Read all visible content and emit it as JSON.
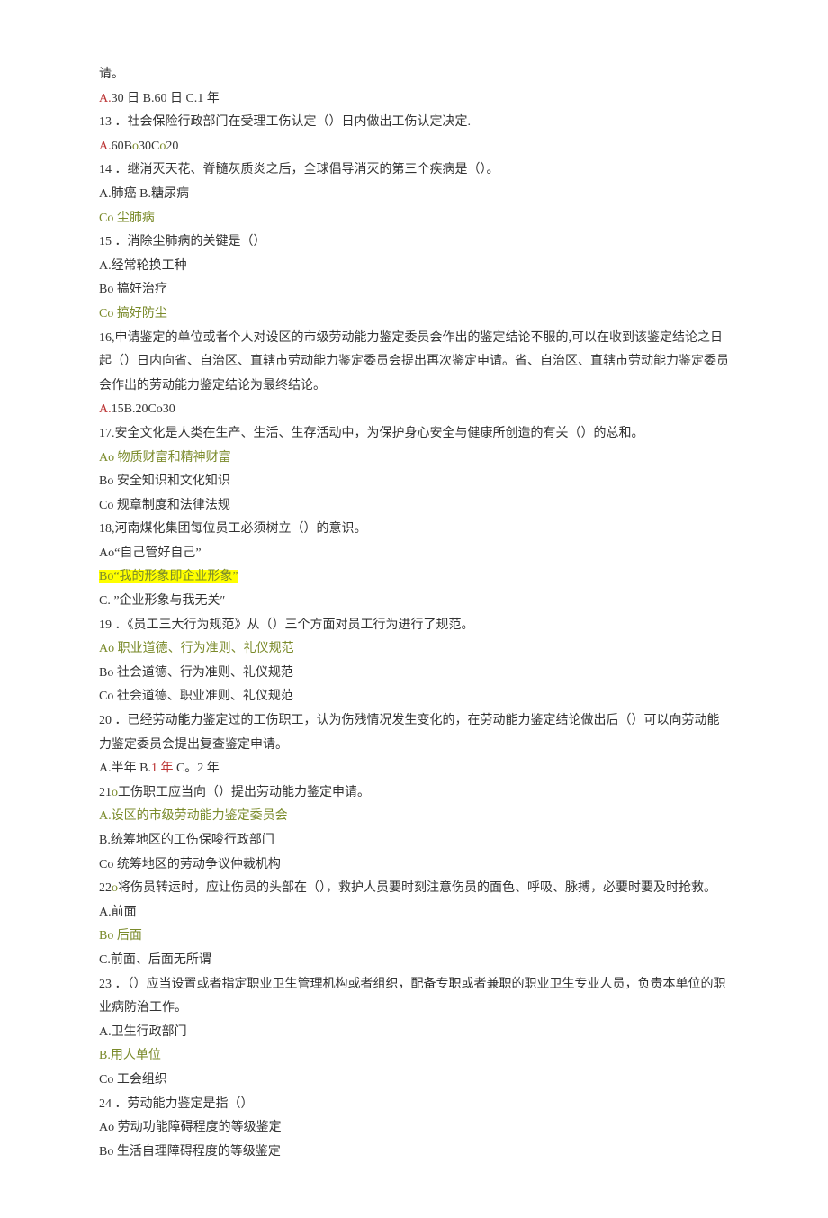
{
  "lines": [
    {
      "segments": [
        {
          "text": "请。"
        }
      ]
    },
    {
      "segments": [
        {
          "text": "A.",
          "cls": "num"
        },
        {
          "text": "30 日 B.60 日 C.1 年"
        }
      ]
    },
    {
      "segments": [
        {
          "text": "13 ．社会保险行政部门在受理工伤认定（）日内做出工伤认定决定."
        }
      ]
    },
    {
      "segments": [
        {
          "text": "A.",
          "cls": "num"
        },
        {
          "text": "60B"
        },
        {
          "text": "o",
          "cls": "ocr"
        },
        {
          "text": "30C"
        },
        {
          "text": "o",
          "cls": "ocr"
        },
        {
          "text": "20"
        }
      ]
    },
    {
      "segments": [
        {
          "text": "14 ．继消灭天花、脊髓灰质炎之后，全球倡导消灭的第三个疾病是（）。"
        }
      ]
    },
    {
      "segments": [
        {
          "text": "A."
        },
        {
          "text": "肺癌 B.糖尿病"
        }
      ]
    },
    {
      "segments": [
        {
          "text": "Co 尘肺病",
          "cls": "ocr"
        }
      ]
    },
    {
      "segments": [
        {
          "text": "15 ．消除尘肺病的关键是（）"
        }
      ]
    },
    {
      "segments": [
        {
          "text": "A.经常轮换工种"
        }
      ]
    },
    {
      "segments": [
        {
          "text": "Bo 搞好治疗"
        }
      ]
    },
    {
      "segments": [
        {
          "text": "Co 搞好防尘",
          "cls": "ocr"
        }
      ]
    },
    {
      "segments": [
        {
          "text": "16,申请鉴定的单位或者个人对设区的市级劳动能力鉴定委员会作出的鉴定结论不服的,可以在收到该鉴定结论之日起（）日内向省、自治区、直辖市劳动能力鉴定委员会提出再次鉴定申请。省、自治区、直辖市劳动能力鉴定委员会作出的劳动能力鉴定结论为最终结论。"
        }
      ]
    },
    {
      "segments": [
        {
          "text": "A.",
          "cls": "num"
        },
        {
          "text": "15B.20Co30"
        }
      ]
    },
    {
      "segments": [
        {
          "text": "17.安全文化是人类在生产、生活、生存活动中，为保护身心安全与健康所创造的有关（）的总和。"
        }
      ]
    },
    {
      "segments": [
        {
          "text": "Ao 物质财富和精神财富",
          "cls": "ocr"
        }
      ]
    },
    {
      "segments": [
        {
          "text": "Bo 安全知识和文化知识"
        }
      ]
    },
    {
      "segments": [
        {
          "text": "Co 规章制度和法律法规"
        }
      ]
    },
    {
      "segments": [
        {
          "text": "18,河南煤化集团每位员工必须树立（）的意识。"
        }
      ]
    },
    {
      "segments": [
        {
          "text": "Ao“自己管好自己”"
        }
      ]
    },
    {
      "segments": [
        {
          "text": "Bo“我的形象即企业形象”",
          "cls": "ocr hl"
        }
      ]
    },
    {
      "segments": [
        {
          "text": "C. ”企业形象与我无关″"
        }
      ]
    },
    {
      "segments": [
        {
          "text": "19 ．《员工三大行为规范》从（）三个方面对员工行为进行了规范。"
        }
      ]
    },
    {
      "segments": [
        {
          "text": "Ao 职业道德、行为准则、礼仪规范",
          "cls": "ocr"
        }
      ]
    },
    {
      "segments": [
        {
          "text": "Bo 社会道德、行为准则、礼仪规范"
        }
      ]
    },
    {
      "segments": [
        {
          "text": "Co 社会道德、职业准则、礼仪规范"
        }
      ]
    },
    {
      "segments": [
        {
          "text": "20 ．已经劳动能力鉴定过的工伤职工，认为伤残情况发生变化的，在劳动能力鉴定结论做出后（）可以向劳动能力鉴定委员会提出复查鉴定申请。"
        }
      ]
    },
    {
      "segments": [
        {
          "text": "A."
        },
        {
          "text": "半年 B."
        },
        {
          "text": "1 年",
          "cls": "num"
        },
        {
          "text": " C。2 年"
        }
      ]
    },
    {
      "segments": [
        {
          "text": "21"
        },
        {
          "text": "o",
          "cls": "ocr"
        },
        {
          "text": "工伤职工应当向（）提出劳动能力鉴定申请。"
        }
      ]
    },
    {
      "segments": [
        {
          "text": "A.设区的市级劳动能力鉴定委员会",
          "cls": "ocr"
        }
      ]
    },
    {
      "segments": [
        {
          "text": "B.统筹地区的工伤保唆行政部门"
        }
      ]
    },
    {
      "segments": [
        {
          "text": "Co 统筹地区的劳动争议仲裁机构"
        }
      ]
    },
    {
      "segments": [
        {
          "text": "22"
        },
        {
          "text": "o",
          "cls": "ocr"
        },
        {
          "text": "将伤员转运时，应让伤员的头部在（），救护人员要时刻注意伤员的面色、呼吸、脉搏，必要时要及时抢救。"
        }
      ]
    },
    {
      "segments": [
        {
          "text": "A.前面"
        }
      ]
    },
    {
      "segments": [
        {
          "text": "Bo 后面",
          "cls": "ocr"
        }
      ]
    },
    {
      "segments": [
        {
          "text": "C.前面、后面无所谓"
        }
      ]
    },
    {
      "segments": [
        {
          "text": "23 ．（）应当设置或者指定职业卫生管理机构或者组织，配备专职或者兼职的职业卫生专业人员，负责本单位的职业病防治工作。"
        }
      ]
    },
    {
      "segments": [
        {
          "text": "A.卫生行政部门"
        }
      ]
    },
    {
      "segments": [
        {
          "text": "B.用人单位",
          "cls": "ocr"
        }
      ]
    },
    {
      "segments": [
        {
          "text": "Co 工会组织"
        }
      ]
    },
    {
      "segments": [
        {
          "text": "24 ．劳动能力鉴定是指（）"
        }
      ]
    },
    {
      "segments": [
        {
          "text": "Ao 劳动功能障碍程度的等级鉴定"
        }
      ]
    },
    {
      "segments": [
        {
          "text": "Bo 生活自理障碍程度的等级鉴定"
        }
      ]
    }
  ]
}
